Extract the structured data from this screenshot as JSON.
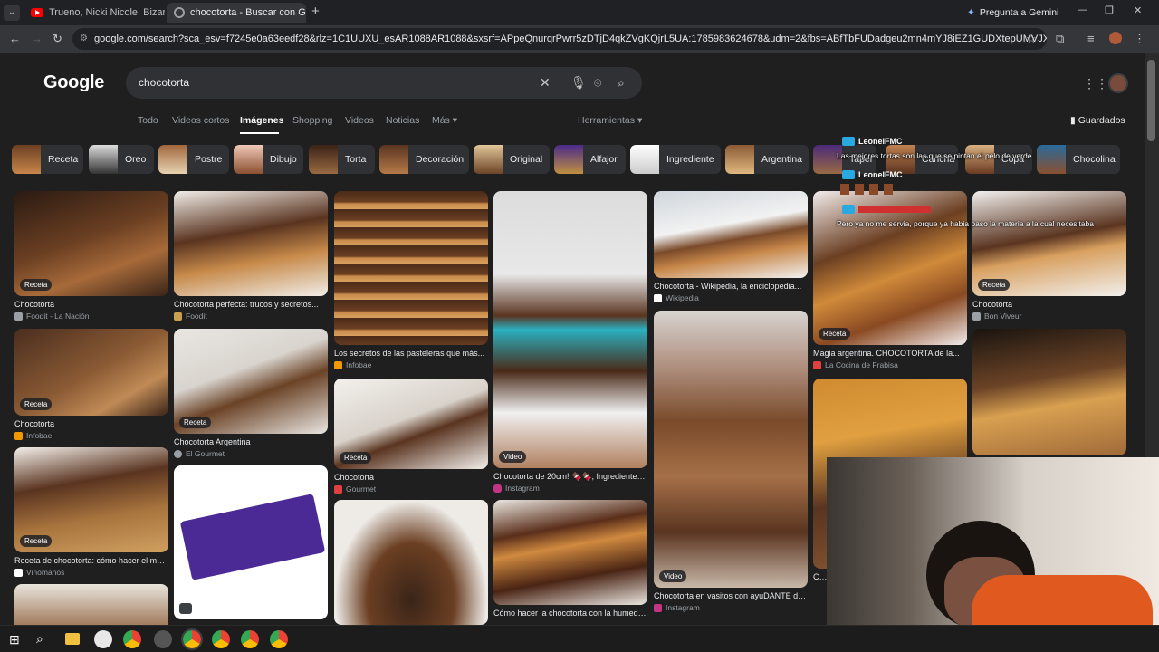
{
  "browser": {
    "tabs": [
      {
        "title": "Trueno, Nicki Nicole, Bizarr...",
        "favicon": "youtube-icon"
      },
      {
        "title": "chocotorta - Buscar con Google",
        "favicon": "google-icon"
      }
    ],
    "new_tab_label": "+",
    "gemini_label": "Pregunta a Gemini",
    "url": "google.com/search?sca_esv=f7245e0a63eedf28&rlz=1C1UUXU_esAR1088AR1088&sxsrf=APpeQnurqrPwrr5zDTjD4qkZVgKQjrL5UA:1785983624678&udm=2&fbs=ABfTbFUDadgeu2mn4mYJ8iEZ1GUDXtepUMVJXDMtqDc3xxrzVcNe-X89UXh8CJrA-yv6..."
  },
  "google": {
    "logo": "Google",
    "query": "chocotorta",
    "nav": [
      "Todo",
      "Videos cortos",
      "Imágenes",
      "Shopping",
      "Videos",
      "Noticias",
      "Más"
    ],
    "tools": "Herramientas",
    "saved": "Guardados",
    "chips": [
      "Receta",
      "Oreo",
      "Postre",
      "Dibujo",
      "Torta",
      "Decoración",
      "Original",
      "Alfajor",
      "Ingrediente",
      "Argentina",
      "Taper",
      "Cancha",
      "Copa",
      "Chocolina"
    ],
    "results": [
      {
        "caption": "Chocotorta",
        "source": "Foodit - La Nación",
        "badge": "Receta"
      },
      {
        "caption": "Chocotorta perfecta: trucos y secretos...",
        "source": "Foodit",
        "badge": ""
      },
      {
        "caption": "Los secretos de las pasteleras que más...",
        "source": "Infobae",
        "badge": ""
      },
      {
        "caption": "Chocotorta de 20cm! 🍫🍫, Ingredientes: 🍫...",
        "source": "Instagram",
        "badge": "Video"
      },
      {
        "caption": "Chocotorta - Wikipedia, la enciclopedia...",
        "source": "Wikipedia",
        "badge": ""
      },
      {
        "caption": "Magia argentina. CHOCOTORTA de la...",
        "source": "La Cocina de Frabisa",
        "badge": "Receta"
      },
      {
        "caption": "Chocotorta",
        "source": "Bon Viveur",
        "badge": "Receta"
      },
      {
        "caption": "Chocotorta",
        "source": "Infobae",
        "badge": "Receta"
      },
      {
        "caption": "Chocotorta Argentina",
        "source": "El Gourmet",
        "badge": "Receta"
      },
      {
        "caption": "Chocotorta",
        "source": "Gourmet",
        "badge": "Receta"
      },
      {
        "caption": "Chocotorta en vasitos con ayuDANTE de...",
        "source": "Instagram",
        "badge": "Video"
      },
      {
        "caption": "Receta de chocotorta: cómo hacer el mejo...",
        "source": "Vinómanos",
        "badge": "Receta"
      },
      {
        "caption": "Cómo hacer la chocotorta con la humeda...",
        "source": "",
        "badge": ""
      },
      {
        "caption": "CHC",
        "source": "",
        "badge": ""
      }
    ]
  },
  "stream_chat": [
    {
      "user": "LeonelFMC",
      "message": "Las mejores tortas son las que se pintan el pelo de verde"
    },
    {
      "user": "LeonelFMC",
      "message": ""
    },
    {
      "user": "",
      "message": "Pero ya no me servia, porque ya habia paso la materia a la cual necesitaba"
    }
  ],
  "colors": {
    "accent": "#8ab4f8",
    "bg": "#1f1f1f",
    "chip": "#303134"
  }
}
